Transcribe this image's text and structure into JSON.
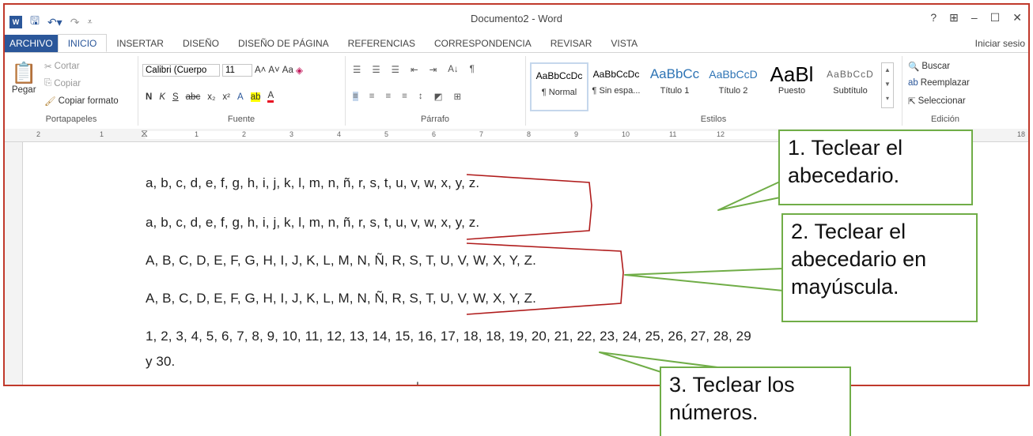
{
  "window": {
    "title": "Documento2 - Word",
    "signin": "Iniciar sesio",
    "buttons": [
      "?",
      "⊞",
      "–",
      "☐",
      "✕"
    ]
  },
  "tabs": [
    "ARCHIVO",
    "INICIO",
    "INSERTAR",
    "DISEÑO",
    "DISEÑO DE PÁGINA",
    "REFERENCIAS",
    "CORRESPONDENCIA",
    "REVISAR",
    "VISTA"
  ],
  "ribbon": {
    "clipboard": {
      "paste": "Pegar",
      "cut": "Cortar",
      "copy": "Copiar",
      "format_painter": "Copiar formato",
      "label": "Portapapeles"
    },
    "font": {
      "name": "Calibri (Cuerpo",
      "size": "11",
      "case": "Aa",
      "label": "Fuente"
    },
    "paragraph": {
      "label": "Párrafo"
    },
    "styles": {
      "items": [
        {
          "preview": "AaBbCcDc",
          "name": "¶ Normal"
        },
        {
          "preview": "AaBbCcDc",
          "name": "¶ Sin espa..."
        },
        {
          "preview": "AaBbCc",
          "name": "Título 1"
        },
        {
          "preview": "AaBbCcD",
          "name": "Título 2"
        },
        {
          "preview": "AaBl",
          "name": "Puesto"
        },
        {
          "preview": "AaBbCcD",
          "name": "Subtítulo"
        }
      ],
      "label": "Estilos"
    },
    "editing": {
      "find": "Buscar",
      "replace": "Reemplazar",
      "select": "Seleccionar",
      "label": "Edición"
    }
  },
  "ruler": {
    "left": [
      "2",
      "1"
    ],
    "right": [
      "1",
      "2",
      "3",
      "4",
      "5",
      "6",
      "7",
      "8",
      "9",
      "10",
      "11",
      "12",
      "18"
    ]
  },
  "document": {
    "lines": [
      "a, b, c, d, e, f, g, h, i, j, k, l, m, n, ñ, r, s, t, u, v, w, x, y, z.",
      "a, b, c, d, e, f, g, h, i, j, k, l, m, n, ñ, r, s, t, u, v, w, x, y, z.",
      "A, B, C, D, E, F, G, H, I, J, K, L, M, N, Ñ, R, S, T, U, V, W, X, Y, Z.",
      "A, B, C, D, E, F, G, H, I, J, K, L, M, N, Ñ, R, S, T, U, V, W, X, Y, Z.",
      "1, 2, 3, 4, 5, 6, 7, 8, 9, 10, 11, 12, 13, 14, 15, 16, 17, 18, 18, 19, 20, 21, 22, 23, 24, 25, 26, 27, 28, 29",
      "y 30."
    ]
  },
  "callouts": {
    "c1": [
      "1. Teclear el",
      "abecedario."
    ],
    "c2": [
      "2. Teclear el",
      "abecedario en",
      "mayúscula."
    ],
    "c3": [
      "3. Teclear los",
      "números."
    ]
  },
  "colors": {
    "accent": "#2b579a",
    "frame": "#c0392b",
    "callout_border": "#70ad47",
    "bracket": "#b01c1c"
  }
}
